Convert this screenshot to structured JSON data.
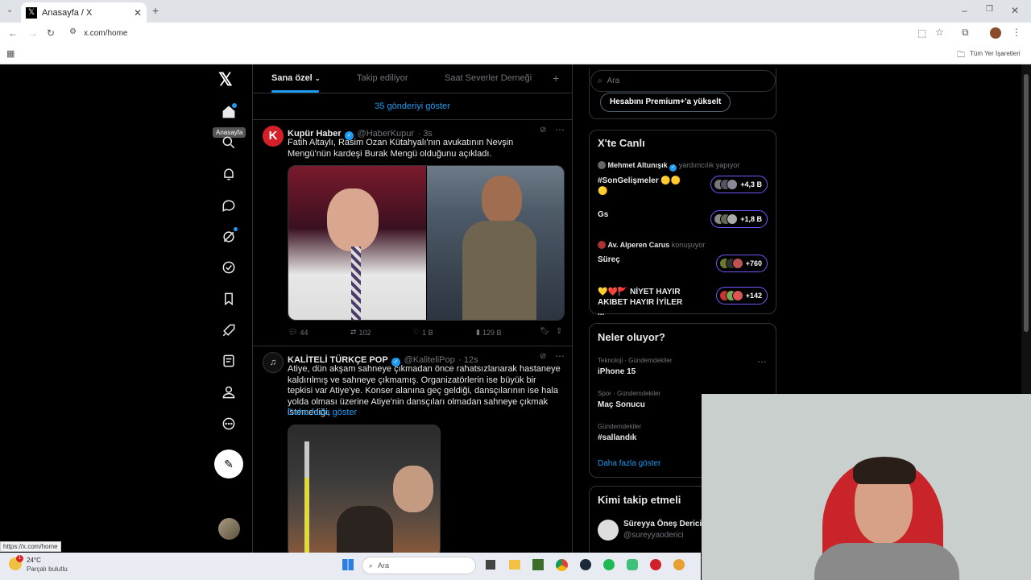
{
  "browser": {
    "tab_title": "Anasayfa / X",
    "url": "x.com/home",
    "bookmarks_label": "Tüm Yer İşaretleri",
    "status_url": "https://x.com/home"
  },
  "sidebar": {
    "tooltip": "Anasayfa",
    "icons": [
      "home-icon",
      "search-icon",
      "bell-icon",
      "messages-icon",
      "grok-icon",
      "verified-icon",
      "bookmark-icon",
      "rocket-icon",
      "lists-icon",
      "profile-icon",
      "more-icon"
    ]
  },
  "timeline": {
    "tabs": [
      "Sana özel",
      "Takip ediliyor",
      "Saat Severler Derneği"
    ],
    "show_new": "35 gönderiyi göster",
    "tweets": [
      {
        "name": "Kupür Haber",
        "handle": "@HaberKupur",
        "time": "· 3s",
        "text": "Fatih Altaylı, Rasim Ozan Kütahyalı'nın avukatının Nevşin Mengü'nün kardeşi Burak Mengü olduğunu açıkladı.",
        "replies": "44",
        "reposts": "102",
        "likes": "1 B",
        "views": "129 B"
      },
      {
        "name": "KALİTELİ TÜRKÇE POP",
        "handle": "@KaliteliPop",
        "time": "· 12s",
        "text": "Atiye, dün akşam sahneye çıkmadan önce rahatsızlanarak hastaneye kaldırılmış ve sahneye çıkmamış. Organizatörlerin ise büyük bir tepkisi var Atiye'ye. Konser alanına geç geldiği, dansçılarının ise hala yolda olması üzerine Atiye'nin dansçıları olmadan sahneye çıkmak istemediği,",
        "more": "Daha fazla göster"
      }
    ]
  },
  "right": {
    "search_placeholder": "Ara",
    "premium_button": "Hesabını Premium+'a yükselt",
    "live": {
      "title": "X'te Canlı",
      "items": [
        {
          "host": "Mehmet Altunışık",
          "status": "yardımcılık yapıyor",
          "topic": "#SonGelişmeler 🟡🟡🟡",
          "count": "+4,3 B"
        },
        {
          "host": "",
          "status": "",
          "topic": "Gs",
          "count": "+1,8 B"
        },
        {
          "host": "Av. Alperen Carus",
          "status": "konuşuyor",
          "topic": "Süreç",
          "count": "+760"
        },
        {
          "host": "",
          "status": "",
          "topic": "💛❤️🚩 NİYET HAYIR AKIBET HAYIR İYİLER ...",
          "count": "+142"
        }
      ]
    },
    "trends": {
      "title": "Neler oluyor?",
      "items": [
        {
          "category": "Teknoloji · Gündemdekiler",
          "name": "iPhone 15"
        },
        {
          "category": "Spor · Gündemdekiler",
          "name": "Maç Sonucu"
        },
        {
          "category": "Gündemdekiler",
          "name": "#sallandık"
        }
      ],
      "more": "Daha fazla göster"
    },
    "follow": {
      "title": "Kimi takip etmeli",
      "name": "Süreyya Öneş Derici",
      "handle": "@sureyyaoderici"
    }
  },
  "taskbar": {
    "temp": "24°C",
    "weather": "Parçalı bulutlu",
    "search": "Ara",
    "badge": "1"
  },
  "colors": {
    "accent": "#1d9bf0",
    "live_border": "#7856ff"
  }
}
